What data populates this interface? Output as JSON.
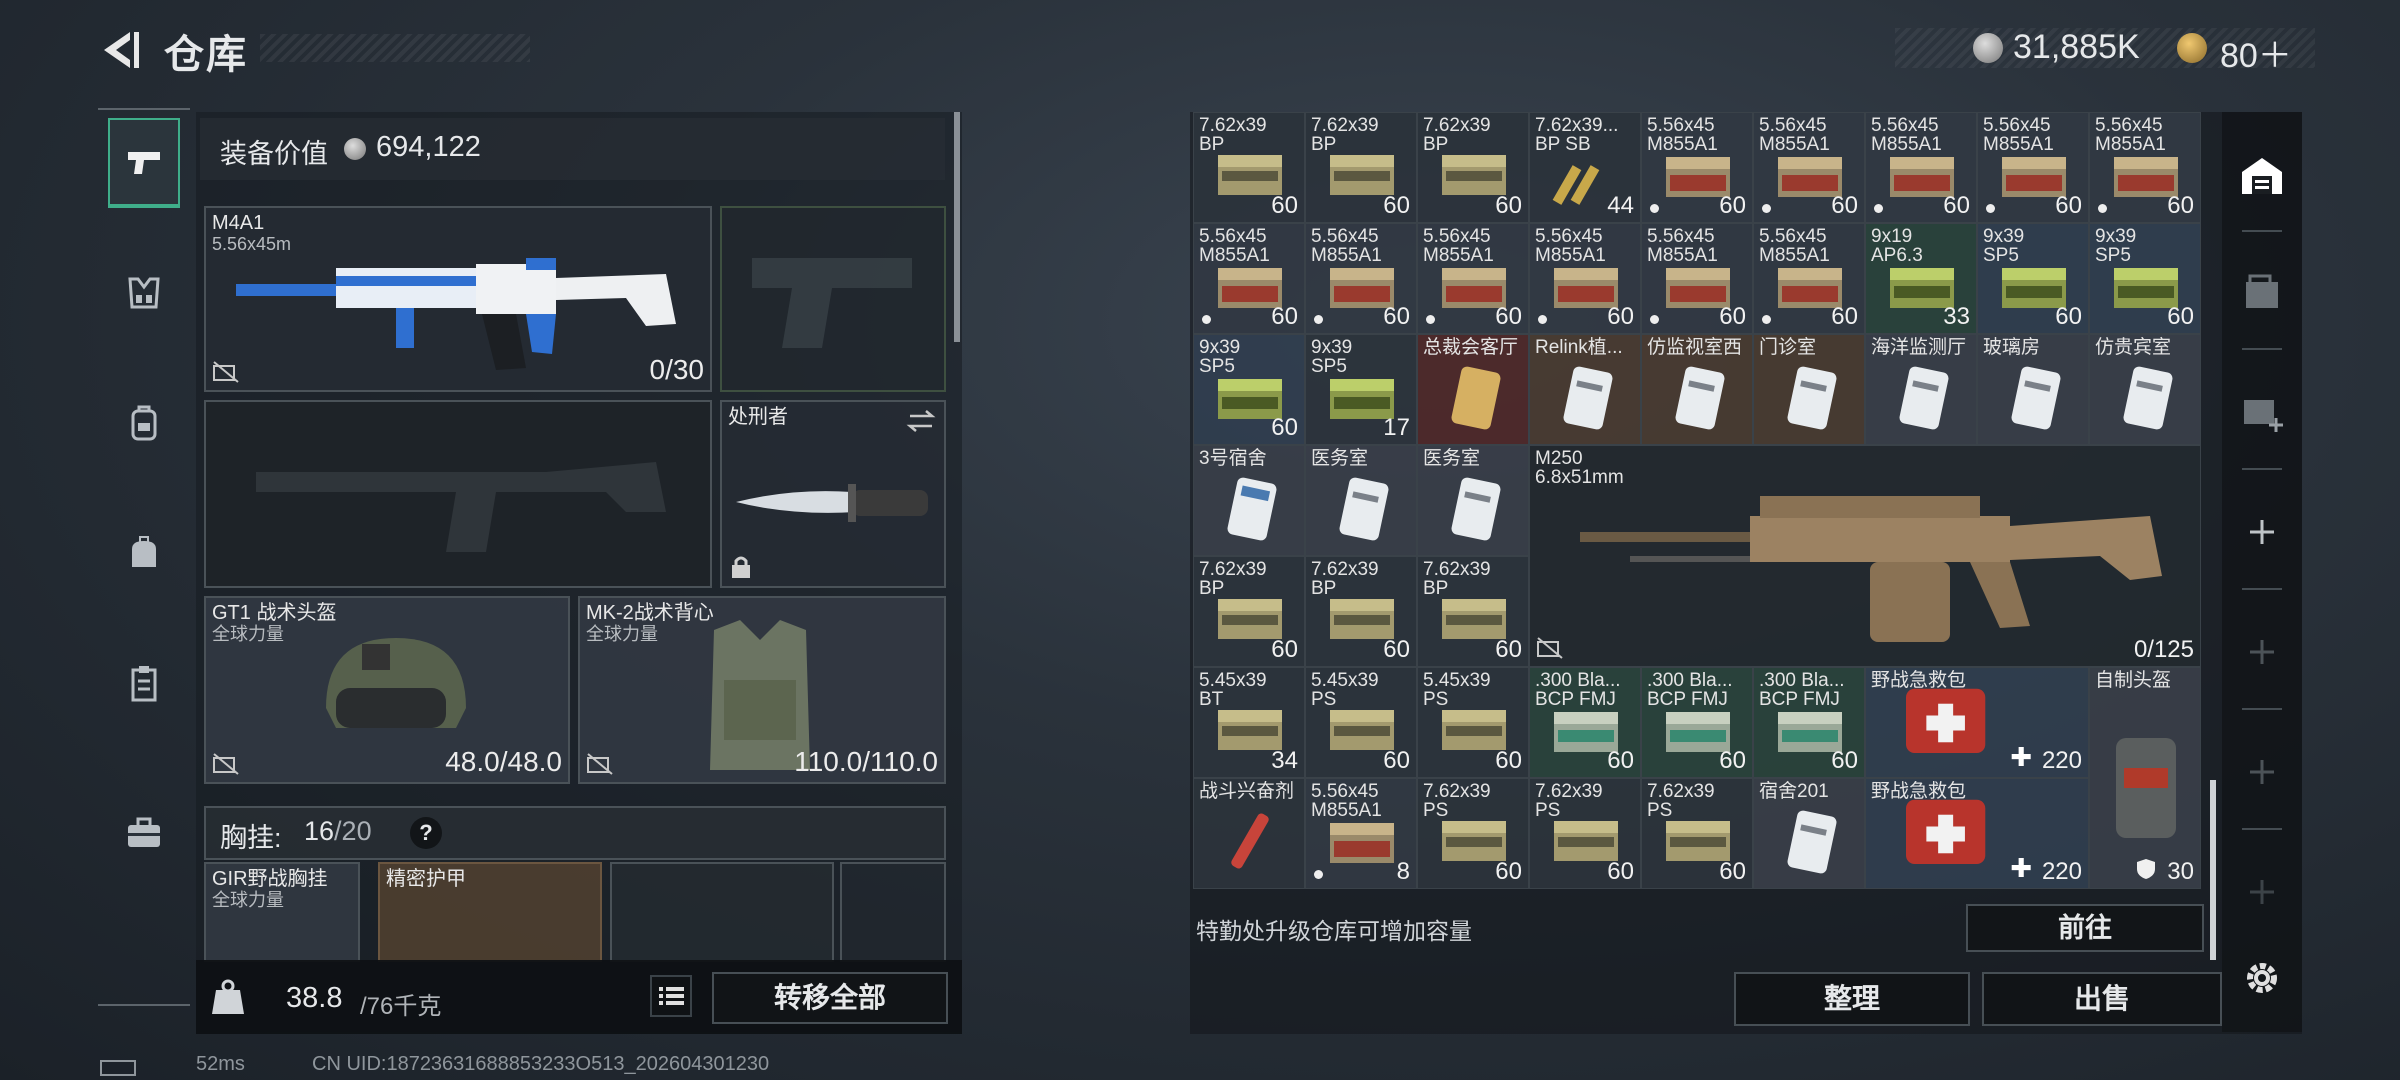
{
  "header": {
    "title": "仓库",
    "coins": "31,885K",
    "gold": "80＋"
  },
  "loadout": {
    "equip_value_label": "装备价值",
    "equip_value": "694,122",
    "primary": {
      "name": "M4A1",
      "caliber": "5.56x45m",
      "ammo": "0/30"
    },
    "melee": {
      "name": "处刑者"
    },
    "helmet": {
      "name": "GT1 战术头盔",
      "faction": "全球力量",
      "durability": "48.0/48.0"
    },
    "armor": {
      "name": "MK-2战术背心",
      "faction": "全球力量",
      "durability": "110.0/110.0"
    },
    "rig": {
      "label": "胸挂:",
      "used": "16",
      "cap": "/20",
      "help": "?"
    },
    "rig_slots": [
      {
        "name": "GIR野战胸挂",
        "faction": "全球力量"
      },
      {
        "name": "精密护甲"
      }
    ],
    "weight": {
      "current": "38.8",
      "max": "/76千克"
    },
    "transfer_all": "转移全部"
  },
  "storage": {
    "cells": [
      {
        "l1": "7.62x39",
        "l2": "BP",
        "qty": "60",
        "dot": false
      },
      {
        "l1": "7.62x39",
        "l2": "BP",
        "qty": "60",
        "dot": false
      },
      {
        "l1": "7.62x39",
        "l2": "BP",
        "qty": "60",
        "dot": false
      },
      {
        "l1": "7.62x39...",
        "l2": "BP SB",
        "qty": "44",
        "dot": false
      },
      {
        "l1": "5.56x45",
        "l2": "M855A1",
        "qty": "60",
        "dot": true
      },
      {
        "l1": "5.56x45",
        "l2": "M855A1",
        "qty": "60",
        "dot": true
      },
      {
        "l1": "5.56x45",
        "l2": "M855A1",
        "qty": "60",
        "dot": true
      },
      {
        "l1": "5.56x45",
        "l2": "M855A1",
        "qty": "60",
        "dot": true
      },
      {
        "l1": "5.56x45",
        "l2": "M855A1",
        "qty": "60",
        "dot": true
      },
      {
        "l1": "5.56x45",
        "l2": "M855A1",
        "qty": "60",
        "dot": true
      },
      {
        "l1": "5.56x45",
        "l2": "M855A1",
        "qty": "60",
        "dot": true
      },
      {
        "l1": "5.56x45",
        "l2": "M855A1",
        "qty": "60",
        "dot": true
      },
      {
        "l1": "5.56x45",
        "l2": "M855A1",
        "qty": "60",
        "dot": true
      },
      {
        "l1": "5.56x45",
        "l2": "M855A1",
        "qty": "60",
        "dot": true
      },
      {
        "l1": "5.56x45",
        "l2": "M855A1",
        "qty": "60",
        "dot": true
      },
      {
        "l1": "9x19",
        "l2": "AP6.3",
        "qty": "33",
        "dot": false
      },
      {
        "l1": "9x39",
        "l2": "SP5",
        "qty": "60",
        "dot": false
      },
      {
        "l1": "9x39",
        "l2": "SP5",
        "qty": "60",
        "dot": false
      },
      {
        "l1": "9x39",
        "l2": "SP5",
        "qty": "60",
        "dot": false
      },
      {
        "l1": "9x39",
        "l2": "SP5",
        "qty": "17",
        "dot": false
      },
      {
        "l1": "总裁会客厅",
        "l2": "",
        "qty": "",
        "dot": false
      },
      {
        "l1": "Relink植...",
        "l2": "",
        "qty": "",
        "dot": false
      },
      {
        "l1": "仿监视室西",
        "l2": "",
        "qty": "",
        "dot": false
      },
      {
        "l1": "门诊室",
        "l2": "",
        "qty": "",
        "dot": false
      },
      {
        "l1": "海洋监测厅",
        "l2": "",
        "qty": "",
        "dot": false
      },
      {
        "l1": "玻璃房",
        "l2": "",
        "qty": "",
        "dot": false
      },
      {
        "l1": "仿贵宾室",
        "l2": "",
        "qty": "",
        "dot": false
      },
      {
        "l1": "3号宿舍",
        "l2": "",
        "qty": "",
        "dot": false
      },
      {
        "l1": "医务室",
        "l2": "",
        "qty": "",
        "dot": false
      },
      {
        "l1": "医务室",
        "l2": "",
        "qty": "",
        "dot": false
      },
      {
        "l1": "M250",
        "l2": "6.8x51mm",
        "qty": "0/125",
        "dot": false
      },
      {
        "l1": "7.62x39",
        "l2": "BP",
        "qty": "60",
        "dot": false
      },
      {
        "l1": "7.62x39",
        "l2": "BP",
        "qty": "60",
        "dot": false
      },
      {
        "l1": "7.62x39",
        "l2": "BP",
        "qty": "60",
        "dot": false
      },
      {
        "l1": "5.45x39",
        "l2": "BT",
        "qty": "34",
        "dot": false
      },
      {
        "l1": "5.45x39",
        "l2": "PS",
        "qty": "60",
        "dot": false
      },
      {
        "l1": "5.45x39",
        "l2": "PS",
        "qty": "60",
        "dot": false
      },
      {
        "l1": ".300 Bla...",
        "l2": "BCP FMJ",
        "qty": "60",
        "dot": false
      },
      {
        "l1": ".300 Bla...",
        "l2": "BCP FMJ",
        "qty": "60",
        "dot": false
      },
      {
        "l1": ".300 Bla...",
        "l2": "BCP FMJ",
        "qty": "60",
        "dot": false
      },
      {
        "l1": "野战急救包",
        "l2": "",
        "qty": "220",
        "dot": false
      },
      {
        "l1": "自制头盔",
        "l2": "",
        "qty": "30",
        "dot": false
      },
      {
        "l1": "战斗兴奋剂",
        "l2": "",
        "qty": "",
        "dot": false
      },
      {
        "l1": "5.56x45",
        "l2": "M855A1",
        "qty": "8",
        "dot": true
      },
      {
        "l1": "7.62x39",
        "l2": "PS",
        "qty": "60",
        "dot": false
      },
      {
        "l1": "7.62x39",
        "l2": "PS",
        "qty": "60",
        "dot": false
      },
      {
        "l1": "7.62x39",
        "l2": "PS",
        "qty": "60",
        "dot": false
      },
      {
        "l1": "宿舍201",
        "l2": "",
        "qty": "",
        "dot": false
      },
      {
        "l1": "野战急救包",
        "l2": "",
        "qty": "220",
        "dot": false
      }
    ],
    "upgrade_hint": "特勤处升级仓库可增加容量",
    "goto": "前往",
    "sort": "整理",
    "sell": "出售"
  },
  "status": {
    "ping": "52ms",
    "uid": "CN UID:18723631688853233O513_202604301230"
  },
  "colors": {
    "accent": "#3fae8a",
    "panel": "#262c34"
  }
}
